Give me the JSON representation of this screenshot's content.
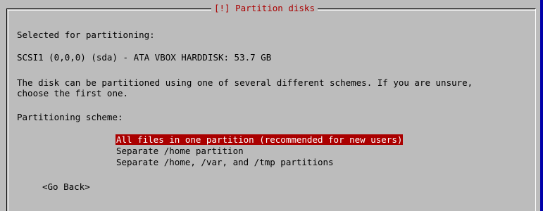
{
  "dialog": {
    "title": "[!] Partition disks",
    "selected_label": "Selected for partitioning:",
    "disk": "SCSI1 (0,0,0) (sda) - ATA VBOX HARDDISK: 53.7 GB",
    "description_line1": "The disk can be partitioned using one of several different schemes. If you are unsure,",
    "description_line2": "choose the first one.",
    "scheme_label": "Partitioning scheme:",
    "options": [
      {
        "label": "All files in one partition (recommended for new users)",
        "selected": true
      },
      {
        "label": "Separate /home partition",
        "selected": false
      },
      {
        "label": "Separate /home, /var, and /tmp partitions",
        "selected": false
      }
    ],
    "go_back": "<Go Back>"
  },
  "colors": {
    "background": "#bcbcbc",
    "title": "#aa0000",
    "highlight": "#aa0000",
    "highlight_text": "#ffffff"
  }
}
